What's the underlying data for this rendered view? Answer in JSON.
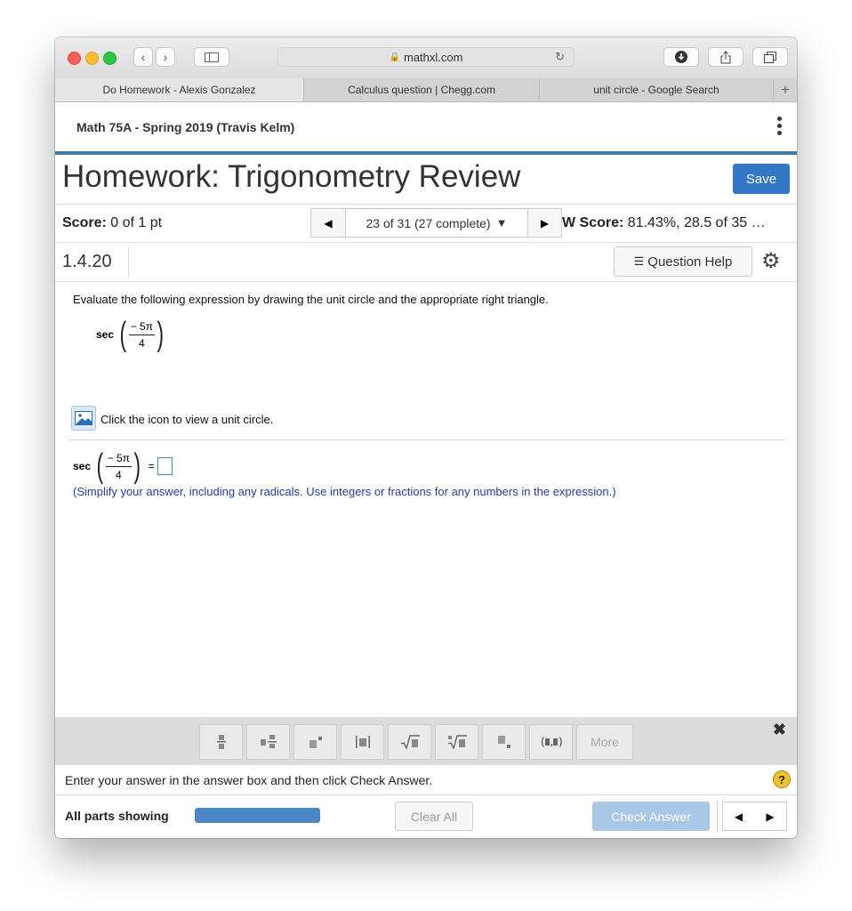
{
  "browser": {
    "url": "mathxl.com",
    "tabs": [
      {
        "label": "Do Homework - Alexis Gonzalez"
      },
      {
        "label": "Calculus question | Chegg.com"
      },
      {
        "label": "unit circle - Google Search"
      }
    ]
  },
  "course": {
    "title": "Math 75A - Spring 2019 (Travis Kelm)"
  },
  "homework": {
    "title": "Homework: Trigonometry Review",
    "save_label": "Save"
  },
  "score": {
    "label": "Score:",
    "value": "0 of 1 pt",
    "nav_label": "23 of 31 (27 complete)",
    "hw_label": "W Score:",
    "hw_value": "81.43%, 28.5 of 35 …"
  },
  "question": {
    "number": "1.4.20",
    "help_label": "Question Help",
    "prompt": "Evaluate the following expression by drawing the unit circle and the appropriate right triangle.",
    "fn": "sec",
    "numerator": "− 5π",
    "denominator": "4",
    "image_caption": "Click the icon to view a unit circle.",
    "equals": "=",
    "hint": "(Simplify your answer, including any radicals. Use integers or fractions for any numbers in the expression.)"
  },
  "palette": {
    "more_label": "More"
  },
  "status": {
    "text": "Enter your answer in the answer box and then click Check Answer."
  },
  "footer": {
    "parts_label": "All parts showing",
    "progress": 1.0,
    "clear_label": "Clear All",
    "check_label": "Check Answer"
  },
  "colors": {
    "accent": "#3378c4",
    "course_bar": "#3b7d9c",
    "hint": "#1f3e9e"
  }
}
